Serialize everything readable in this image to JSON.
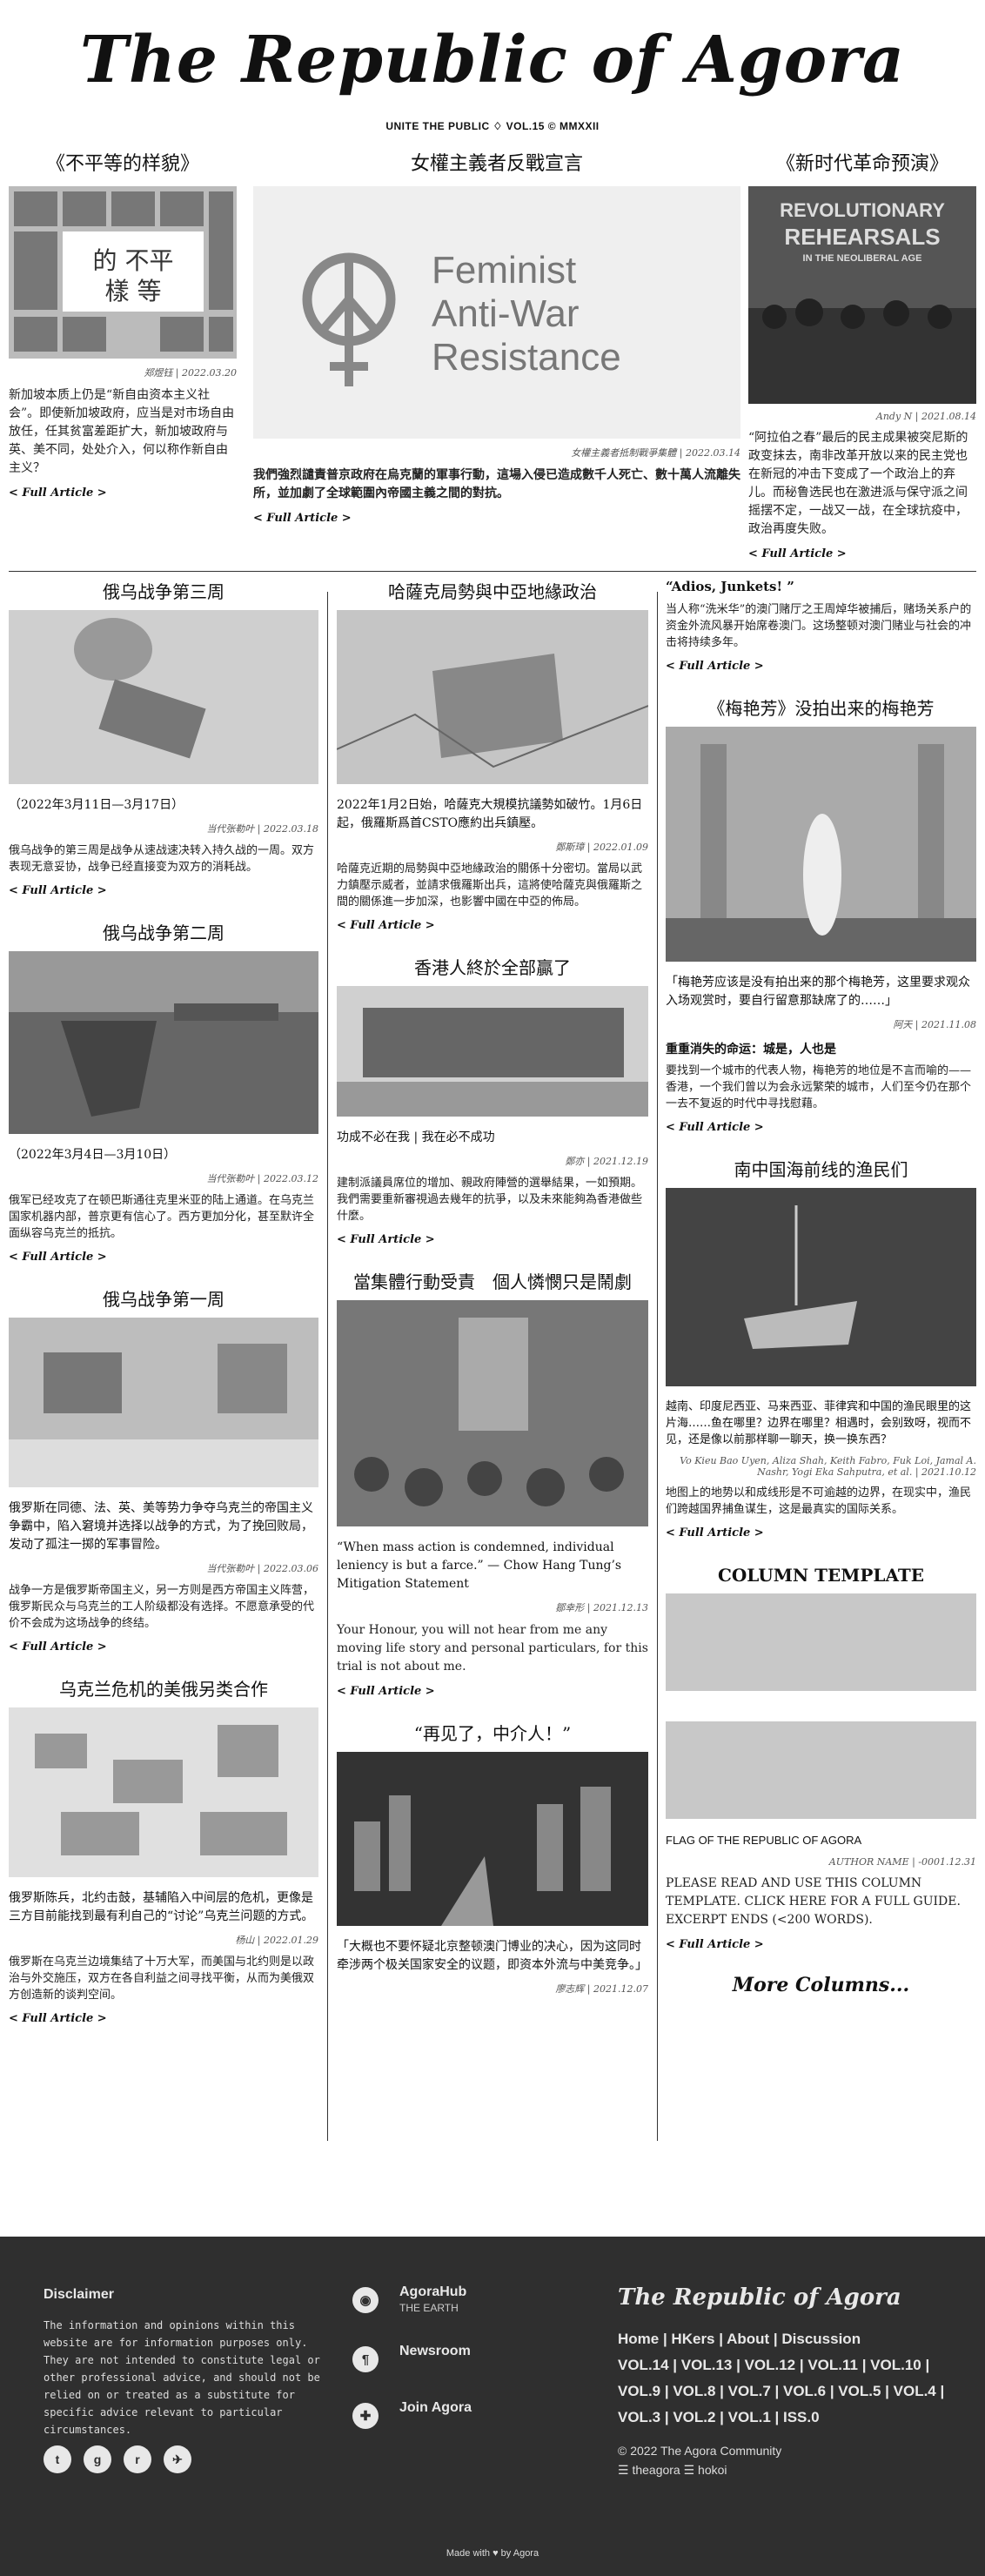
{
  "masthead": {
    "title": "The Republic of Agora",
    "tagline": "UNITE THE PUBLIC ♢ VOL.15 © MMXXII"
  },
  "hero": {
    "left": {
      "title": "《不平等的样貌》",
      "meta": "郑煜钰 | 2022.03.20",
      "body": "新加坡本质上仍是“新自由资本主义社会”。即使新加坡政府，应当是对市场自由放任，任其贫富差距扩大，新加坡政府与英、美不同，处处介入，何以称作新自由主义？",
      "more": "< Full Article >"
    },
    "mid": {
      "title": "女權主義者反戰宣言",
      "logo_lines": [
        "Feminist",
        "Anti-War",
        "Resistance"
      ],
      "meta": "女權主義者抵制戰爭集體 | 2022.03.14",
      "body": "我們強烈譴責普京政府在烏克蘭的軍事行動，這場入侵已造成數千人死亡、數十萬人流離失所，並加劇了全球範圍內帝國主義之間的對抗。",
      "more": "< Full Article >"
    },
    "right": {
      "title": "《新时代革命预演》",
      "cover_lines": [
        "REVOLUTIONARY",
        "REHEARSALS",
        "IN THE NEOLIBERAL AGE"
      ],
      "meta": "Andy N | 2021.08.14",
      "body": "“阿拉伯之春”最后的民主成果被突尼斯的政变抹去，南非改革开放以来的民主党也在新冠的冲击下变成了一个政治上的弃儿。而秘鲁选民也在激进派与保守派之间摇摆不定，一战又一战，在全球抗疫中，政治再度失败。",
      "more": "< Full Article >"
    }
  },
  "col1": [
    {
      "title": "俄乌战争第三周",
      "cap": "（2022年3月11日—3月17日）",
      "meta": "当代张勒叶 | 2022.03.18",
      "body": "俄乌战争的第三周是战争从速战速决转入持久战的一周。双方表现无意妥协，战争已经直接变为双方的消耗战。",
      "more": "< Full Article >"
    },
    {
      "title": "俄乌战争第二周",
      "cap": "（2022年3月4日—3月10日）",
      "meta": "当代张勒叶 | 2022.03.12",
      "body": "俄军已经攻克了在顿巴斯通往克里米亚的陆上通道。在乌克兰国家机器内部，普京更有信心了。西方更加分化，甚至默许全面纵容乌克兰的抵抗。",
      "more": "< Full Article >"
    },
    {
      "title": "俄乌战争第一周",
      "cap": "俄罗斯在同德、法、英、美等势力争夺乌克兰的帝国主义争霸中，陷入窘境并选择以战争的方式，为了挽回败局，发动了孤注一掷的军事冒险。",
      "meta": "当代张勒叶 | 2022.03.06",
      "body": "战争一方是俄罗斯帝国主义，另一方则是西方帝国主义阵营，俄罗斯民众与乌克兰的工人阶级都没有选择。不愿意承受的代价不会成为这场战争的终结。",
      "more": "< Full Article >"
    },
    {
      "title": "乌克兰危机的美俄另类合作",
      "cap": "俄罗斯陈兵，北约击鼓，基辅陷入中间层的危机，更像是三方目前能找到最有利自己的“讨论”乌克兰问题的方式。",
      "meta": "杨山 | 2022.01.29",
      "body": "俄罗斯在乌克兰边境集结了十万大军，而美国与北约则是以政治与外交施压，双方在各自利益之间寻找平衡，从而为美俄双方创造新的谈判空间。",
      "more": "< Full Article >"
    }
  ],
  "col2": [
    {
      "title": "哈薩克局勢與中亞地緣政治",
      "cap": "2022年1月2日始，哈薩克大規模抗議勢如破竹。1月6日起，俄羅斯爲首CSTO應約出兵鎮壓。",
      "meta": "鄭斯璋 | 2022.01.09",
      "body": "哈薩克近期的局勢與中亞地緣政治的關係十分密切。當局以武力鎮壓示威者，並請求俄羅斯出兵，這將使哈薩克與俄羅斯之間的關係進一步加深，也影響中國在中亞的佈局。",
      "more": "< Full Article >"
    },
    {
      "title": "香港人終於全部贏了",
      "cap": "功成不必在我 | 我在必不成功",
      "meta": "鄭亦 | 2021.12.19",
      "body": "建制派議員席位的增加、親政府陣營的選舉結果，一如預期。我們需要重新審視過去幾年的抗爭，以及未來能夠為香港做些什麼。",
      "more": "< Full Article >"
    },
    {
      "title": "當集體行動受責　個人憐憫只是鬧劇",
      "cap": "“When mass action is condemned, individual leniency is but a farce.” — Chow Hang Tung’s Mitigation Statement",
      "meta": "鄒幸形 | 2021.12.13",
      "body": "Your Honour, you will not hear from me any moving life story and personal particulars, for this trial is not about me.",
      "more": "< Full Article >"
    },
    {
      "title": "“再见了，中介人！”",
      "cap": "「大概也不要怀疑北京整顿澳门博业的决心，因为这同时牵涉两个极关国家安全的议题，即资本外流与中美竞争。」",
      "meta": "廖志辉 | 2021.12.07",
      "body": "",
      "more": ""
    }
  ],
  "col3": [
    {
      "title": "“Adios, Junkets! ”",
      "body": "当人称“洗米华”的澳门赌厅之王周焯华被捕后，赌场关系户的资金外流风暴开始席卷澳门。这场整顿对澳门赌业与社会的冲击将持续多年。",
      "more": "< Full Article >"
    },
    {
      "title": "《梅艳芳》没拍出来的梅艳芳",
      "cap": "「梅艳芳应该是没有拍出来的那个梅艳芳，这里要求观众入场观赏时，要自行留意那缺席了的……」",
      "meta": "阿天 | 2021.11.08",
      "subhead": "重重消失的命运：城是，人也是",
      "body": "要找到一个城市的代表人物，梅艳芳的地位是不言而喻的——香港，一个我们曾以为会永远繁荣的城市，人们至今仍在那个一去不复返的时代中寻找慰藉。",
      "more": "< Full Article >"
    },
    {
      "title": "南中国海前线的渔民们",
      "cap": "越南、印度尼西亚、马来西亚、菲律宾和中国的渔民眼里的这片海……鱼在哪里？边界在哪里？相遇时，会别致呀，视而不见，还是像以前那样聊一聊天，换一换东西？",
      "meta": "Vo Kieu Bao Uyen, Aliza Shah, Keith Fabro, Fuk Loi, Jamal A. Nashr, Yogi Eka Sahputra, et al. | 2021.10.12",
      "body": "地图上的地势以和成线形是不可逾越的边界，在现实中，渔民们跨越国界捕鱼谋生，这是最真实的国际关系。",
      "more": "< Full Article >"
    },
    {
      "title": "COLUMN TEMPLATE",
      "cap": "FLAG OF THE REPUBLIC OF AGORA",
      "meta": "AUTHOR NAME | -0001.12.31",
      "body": "PLEASE READ AND USE THIS COLUMN TEMPLATE. CLICK HERE FOR A FULL GUIDE. EXCERPT ENDS (<200 WORDS).",
      "more": "< Full Article >"
    }
  ],
  "more_columns": "More Columns...",
  "footer": {
    "disclaimer_title": "Disclaimer",
    "disclaimer": "The information and opinions within this website are for information purposes only. They are not intended to constitute legal or other professional advice, and should not be relied on or treated as a substitute for specific advice relevant to particular circumstances.",
    "socials": [
      "t",
      "g",
      "r",
      "✈"
    ],
    "links": [
      {
        "label": "AgoraHub",
        "sub": "THE EARTH",
        "icon": "◉"
      },
      {
        "label": "Newsroom",
        "sub": "",
        "icon": "¶"
      },
      {
        "label": "Join Agora",
        "sub": "",
        "icon": "✚"
      }
    ],
    "brand": "The Republic of Agora",
    "nav": "Home | HKers | About | Discussion",
    "vols": "VOL.14 | VOL.13 | VOL.12 | VOL.11 | VOL.10 | VOL.9 | VOL.8 | VOL.7 | VOL.6 | VOL.5 | VOL.4 | VOL.3 | VOL.2 | VOL.1 | ISS.0",
    "copyright": "© 2022 The Agora Community",
    "handles": "☰ theagora ☰ hokoi",
    "made": "Made with ♥ by Agora"
  }
}
